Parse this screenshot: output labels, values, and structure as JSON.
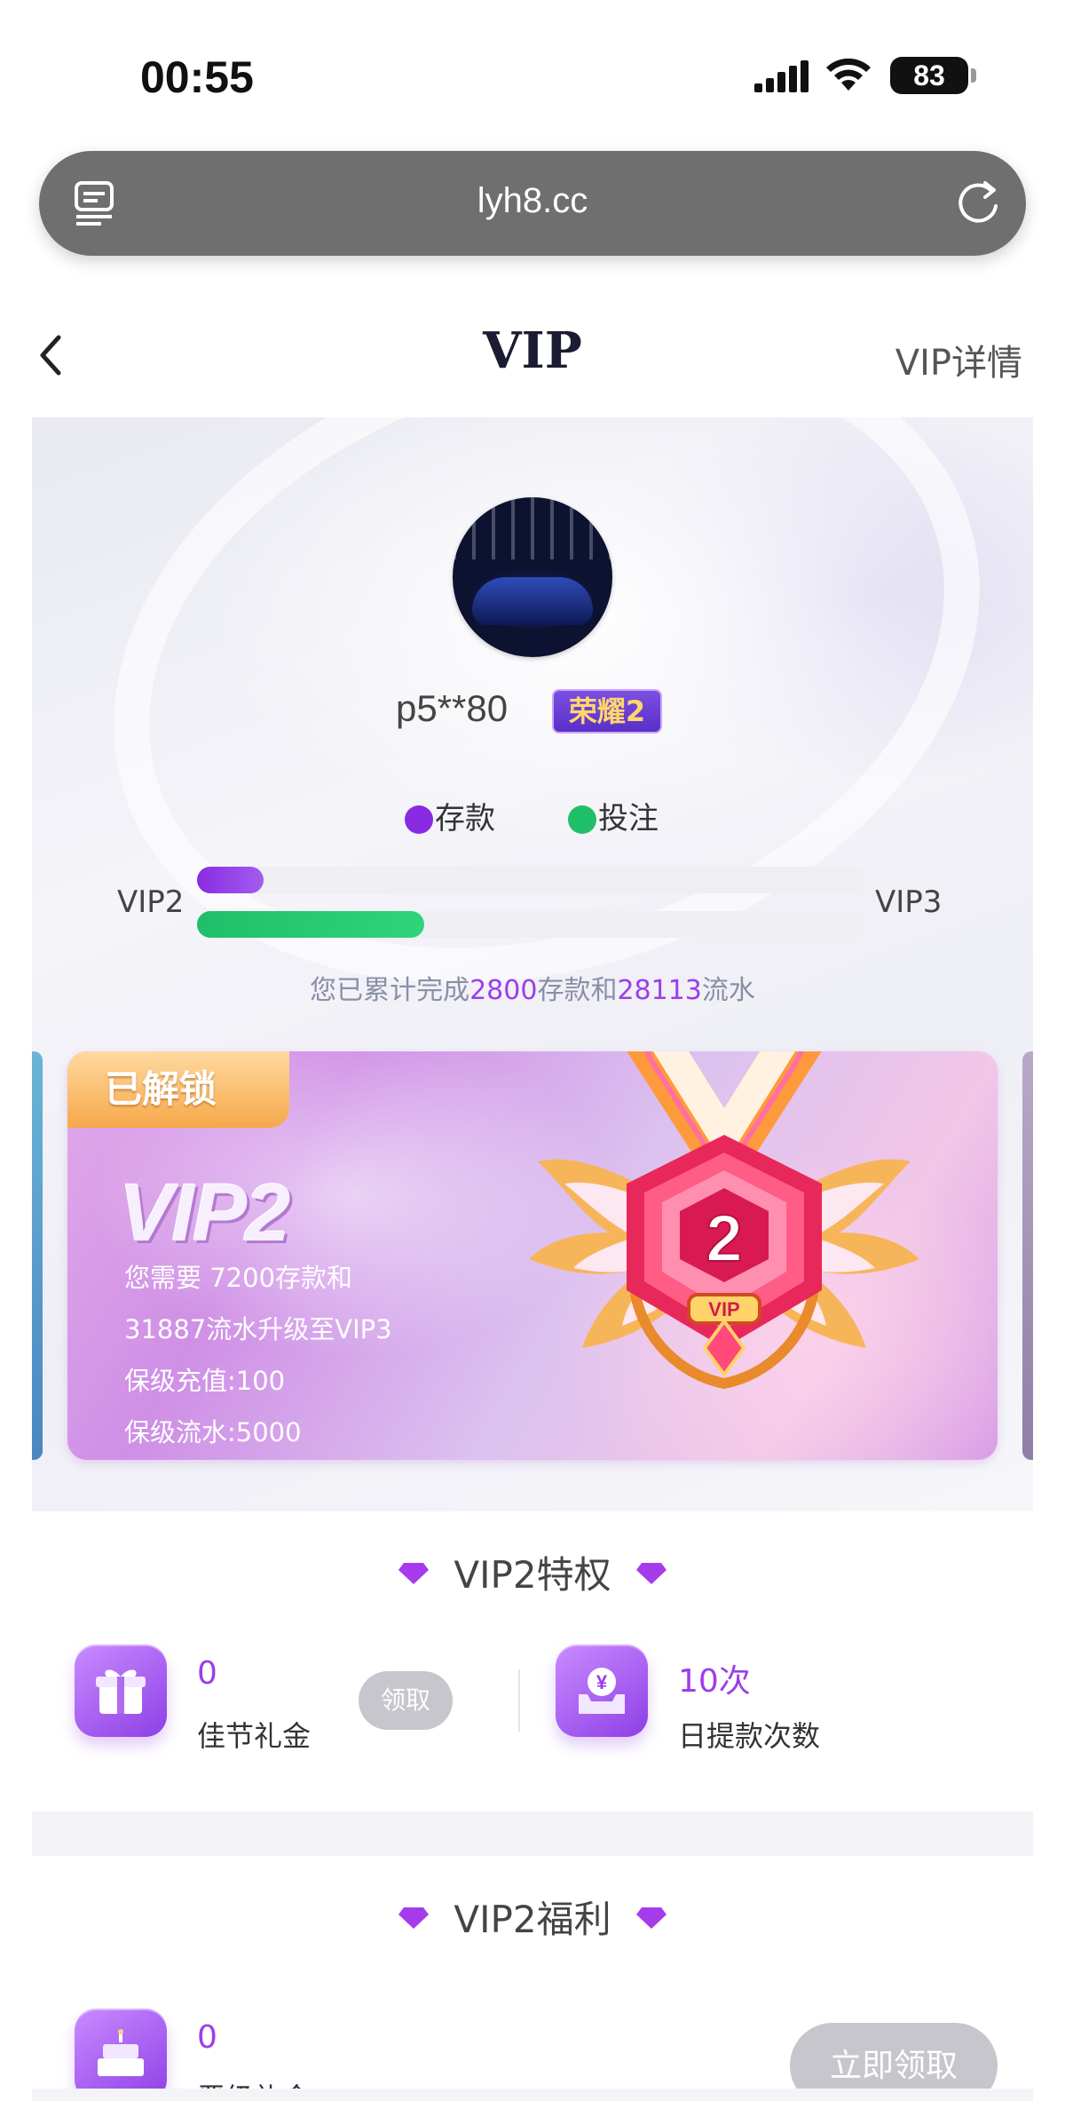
{
  "status": {
    "time": "00:55",
    "battery": "83"
  },
  "browser": {
    "url": "lyh8.cc"
  },
  "nav": {
    "title": "VIP",
    "right_link": "VIP详情"
  },
  "profile": {
    "username": "p5**80",
    "rank_badge": "荣耀2"
  },
  "progress": {
    "legend_deposit": "存款",
    "legend_bet": "投注",
    "current_level": "VIP2",
    "next_level": "VIP3",
    "deposit_fraction": 0.1,
    "bet_fraction": 0.34,
    "deposit_color": "#8a2be2",
    "bet_color": "#1fbf6a",
    "summary_prefix": "您已累计完成",
    "summary_deposit": "2800",
    "summary_mid": "存款和",
    "summary_flow": "28113",
    "summary_suffix": "流水"
  },
  "vip_card": {
    "unlock_tag": "已解锁",
    "level": "VIP2",
    "line1": "您需要 7200存款和",
    "line2": "31887流水升级至VIP3",
    "line3": "保级充值:100",
    "line4": "保级流水:5000",
    "medal_number": "2",
    "medal_label": "VIP"
  },
  "privileges": {
    "title": "VIP2特权",
    "items": [
      {
        "value": "0",
        "label": "佳节礼金",
        "icon": "gift-icon",
        "action": "领取"
      },
      {
        "value": "10次",
        "label": "日提款次数",
        "icon": "withdraw-icon"
      }
    ]
  },
  "welfare": {
    "title": "VIP2福利",
    "items": [
      {
        "value": "0",
        "label": "晋级礼金",
        "icon": "cake-icon",
        "action": "立即领取"
      }
    ]
  },
  "colors": {
    "accent_purple": "#9b3ee8",
    "url_bar": "#6f6f6f",
    "disabled_button": "#c6c6cc"
  }
}
